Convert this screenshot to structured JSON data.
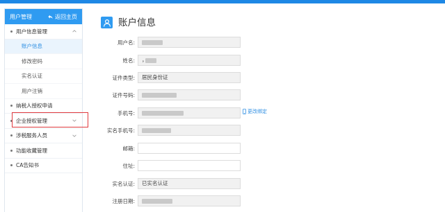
{
  "sidebar": {
    "header_title": "用户管理",
    "home_link": "返回主页",
    "sections": [
      {
        "label": "用户信息管理"
      },
      {
        "label": "纳税人授权申请"
      },
      {
        "label": "企业授权管理"
      },
      {
        "label": "涉税服务人员"
      },
      {
        "label": "功能收藏管理"
      },
      {
        "label": "CA告知书"
      }
    ],
    "sub_items": [
      {
        "label": "账户信息"
      },
      {
        "label": "修改密码"
      },
      {
        "label": "实名认证"
      },
      {
        "label": "用户注销"
      }
    ]
  },
  "page": {
    "title": "账户信息",
    "change_binding": "更改绑定"
  },
  "fields": [
    {
      "label": "用户名:",
      "value": ""
    },
    {
      "label": "姓名:",
      "value": "，"
    },
    {
      "label": "证件类型:",
      "value": "居民身份证"
    },
    {
      "label": "证件号码:",
      "value": ""
    },
    {
      "label": "手机号:",
      "value": ""
    },
    {
      "label": "实名手机号:",
      "value": ""
    },
    {
      "label": "邮箱:",
      "value": ""
    },
    {
      "label": "住址:",
      "value": ""
    },
    {
      "label": "实名认证:",
      "value": "已实名认证"
    },
    {
      "label": "注册日期:",
      "value": ""
    }
  ],
  "colors": {
    "accent": "#2f9bf1",
    "highlight_border": "#e0393e",
    "link": "#2f8fe3"
  }
}
